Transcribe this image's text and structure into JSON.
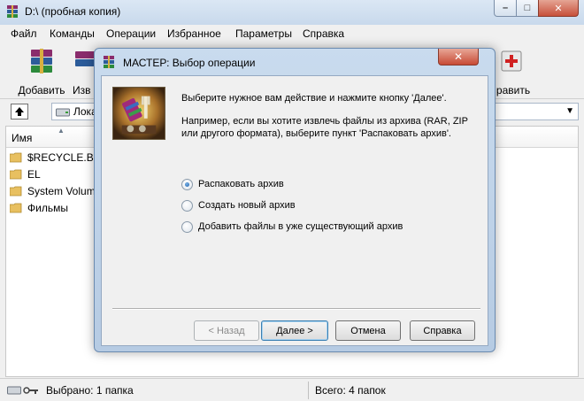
{
  "window": {
    "title": "D:\\ (пробная копия)"
  },
  "menu": [
    {
      "label": "Файл"
    },
    {
      "label": "Команды"
    },
    {
      "label": "Операции"
    },
    {
      "label": "Избранное"
    },
    {
      "label": "Параметры"
    },
    {
      "label": "Справка"
    }
  ],
  "toolbar": {
    "add_label": "Добавить",
    "extract_label_partial": "Изв",
    "delete_label_partial": "равить"
  },
  "address": {
    "text": "Лока"
  },
  "filelist": {
    "column_name": "Имя",
    "items": [
      {
        "name": "$RECYCLE.BIN"
      },
      {
        "name": "EL"
      },
      {
        "name": "System Volum"
      },
      {
        "name": "Фильмы"
      }
    ]
  },
  "status": {
    "selected": "Выбрано: 1 папка",
    "total": "Всего: 4 папок"
  },
  "dialog": {
    "title": "МАСТЕР:  Выбор операции",
    "intro": "Выберите нужное вам действие и нажмите кнопку 'Далее'.",
    "example": "Например, если вы хотите извлечь файлы из архива (RAR, ZIP или другого формата), выберите пункт 'Распаковать архив'.",
    "options": [
      {
        "label": "Распаковать архив",
        "checked": true
      },
      {
        "label": "Создать новый архив",
        "checked": false
      },
      {
        "label": "Добавить файлы в уже существующий архив",
        "checked": false
      }
    ],
    "buttons": {
      "back": "< Назад",
      "next": "Далее >",
      "cancel": "Отмена",
      "help": "Справка"
    }
  },
  "colors": {
    "dialog_frame": "#c9dbee",
    "radio_selected": "#1d5fa8",
    "close_button": "#c74a35"
  }
}
